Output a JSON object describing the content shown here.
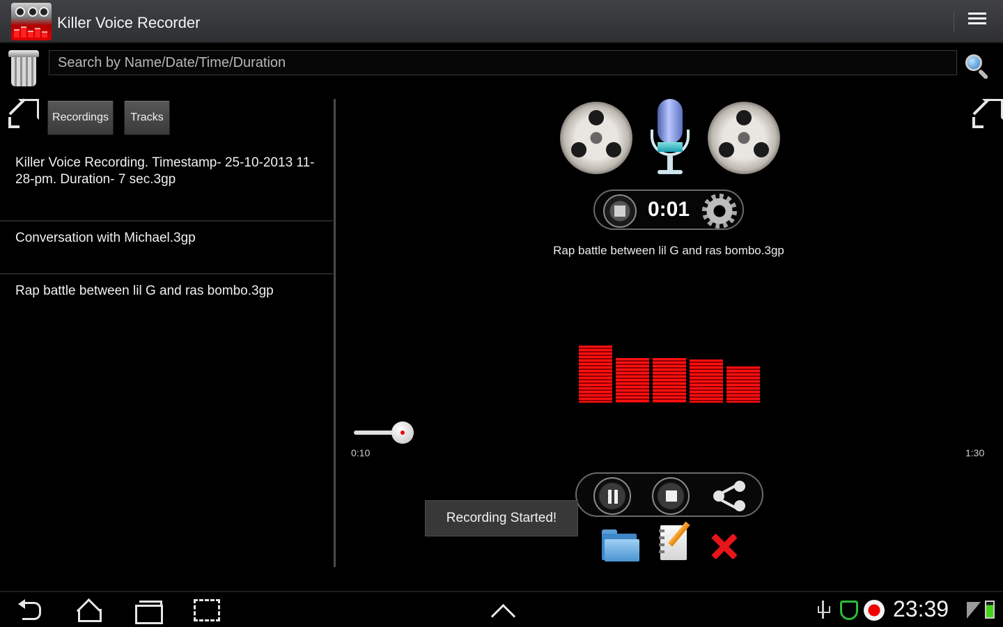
{
  "app": {
    "title": "Killer Voice Recorder"
  },
  "search": {
    "placeholder": "Search by Name/Date/Time/Duration"
  },
  "tabs": [
    {
      "label": "Recordings"
    },
    {
      "label": "Tracks"
    }
  ],
  "recordings": [
    {
      "name": "Killer Voice Recording. Timestamp- 25-10-2013 11-28-pm. Duration- 7 sec.3gp"
    },
    {
      "name": "Conversation with Michael.3gp"
    },
    {
      "name": "Rap battle between lil G and ras bombo.3gp"
    }
  ],
  "recorder": {
    "timer": "0:01",
    "current_file": "Rap battle between lil G and ras bombo.3gp",
    "level_meter": [
      0.82,
      0.64,
      0.64,
      0.62,
      0.52
    ],
    "slider": {
      "min_label": "0:10",
      "max_label": "1:30",
      "position": 0.08
    }
  },
  "toast": {
    "message": "Recording Started!"
  },
  "status_bar": {
    "clock": "23:39"
  },
  "colors": {
    "accent_red": "#e8141a",
    "security_green": "#2bbd3a",
    "battery_green": "#46d21a",
    "folder_blue": "#4a94d0"
  }
}
